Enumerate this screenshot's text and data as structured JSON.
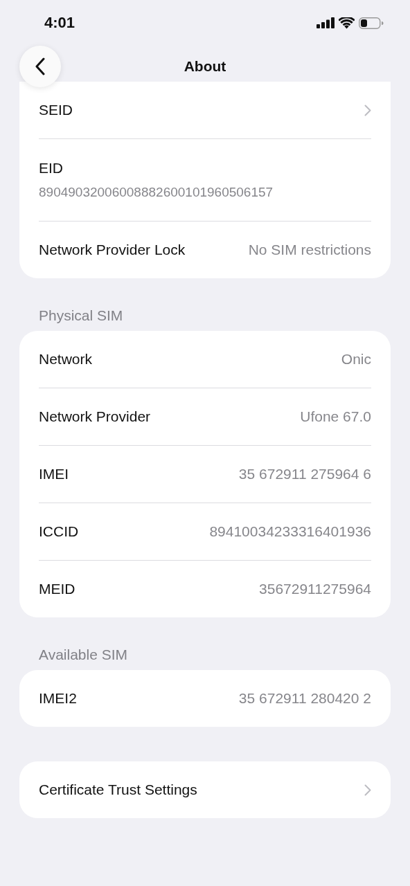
{
  "status_bar": {
    "time": "4:01"
  },
  "nav": {
    "title": "About"
  },
  "groups": [
    {
      "rows": [
        {
          "kind": "link",
          "label": "SEID"
        },
        {
          "kind": "stacked",
          "label": "EID",
          "value": "89049032006008882600101960506157"
        },
        {
          "kind": "value",
          "label": "Network Provider Lock",
          "value": "No SIM restrictions"
        }
      ]
    },
    {
      "header": "Physical SIM",
      "rows": [
        {
          "kind": "value",
          "label": "Network",
          "value": "Onic"
        },
        {
          "kind": "value",
          "label": "Network Provider",
          "value": "Ufone 67.0"
        },
        {
          "kind": "value",
          "label": "IMEI",
          "value": "35 672911 275964 6"
        },
        {
          "kind": "value",
          "label": "ICCID",
          "value": "89410034233316401936"
        },
        {
          "kind": "value",
          "label": "MEID",
          "value": "35672911275964"
        }
      ]
    },
    {
      "header": "Available SIM",
      "rows": [
        {
          "kind": "value",
          "label": "IMEI2",
          "value": "35 672911 280420 2"
        }
      ]
    },
    {
      "rows": [
        {
          "kind": "link",
          "label": "Certificate Trust Settings"
        }
      ]
    }
  ]
}
